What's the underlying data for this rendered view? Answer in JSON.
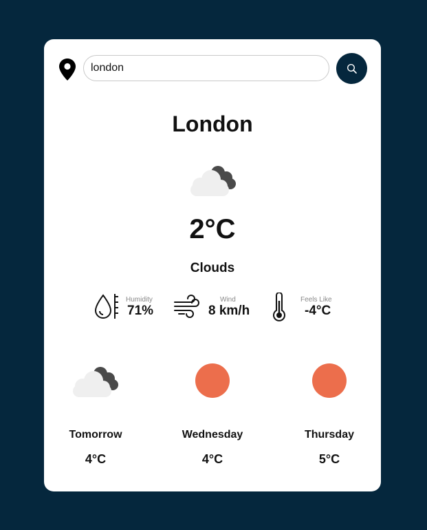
{
  "search": {
    "value": "london"
  },
  "current": {
    "city": "London",
    "icon": "clouds-icon",
    "temperature": "2°C",
    "condition": "Clouds",
    "stats": {
      "humidity": {
        "label": "Humidity",
        "value": "71%"
      },
      "wind": {
        "label": "Wind",
        "value": "8 km/h"
      },
      "feels_like": {
        "label": "Feels Like",
        "value": "-4°C"
      }
    }
  },
  "forecast": [
    {
      "day": "Tomorrow",
      "temp": "4°C",
      "icon": "clouds-icon"
    },
    {
      "day": "Wednesday",
      "temp": "4°C",
      "icon": "sun-icon"
    },
    {
      "day": "Thursday",
      "temp": "5°C",
      "icon": "sun-icon"
    }
  ],
  "colors": {
    "background": "#05273d",
    "card": "#ffffff",
    "sun": "#ec6e4c",
    "cloud_dark": "#4a4a4a",
    "cloud_light": "#eeeeee"
  }
}
